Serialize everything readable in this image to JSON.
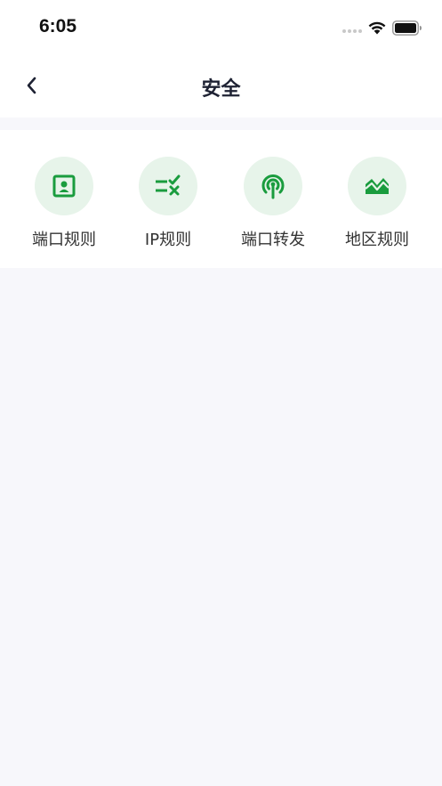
{
  "status_bar": {
    "time": "6:05",
    "wifi_icon": "wifi-icon",
    "battery_icon": "battery-icon"
  },
  "nav": {
    "back_icon": "chevron-left-icon",
    "title": "安全"
  },
  "features": [
    {
      "label": "端口规则",
      "icon": "portrait-frame-icon"
    },
    {
      "label": "IP规则",
      "icon": "rule-check-cross-icon"
    },
    {
      "label": "端口转发",
      "icon": "broadcast-antenna-icon"
    },
    {
      "label": "地区规则",
      "icon": "mountain-map-icon"
    }
  ],
  "colors": {
    "accent": "#1a9c3e",
    "icon_bg": "#e7f4ea",
    "title": "#1e2233",
    "page_bg": "#f7f7fb"
  }
}
